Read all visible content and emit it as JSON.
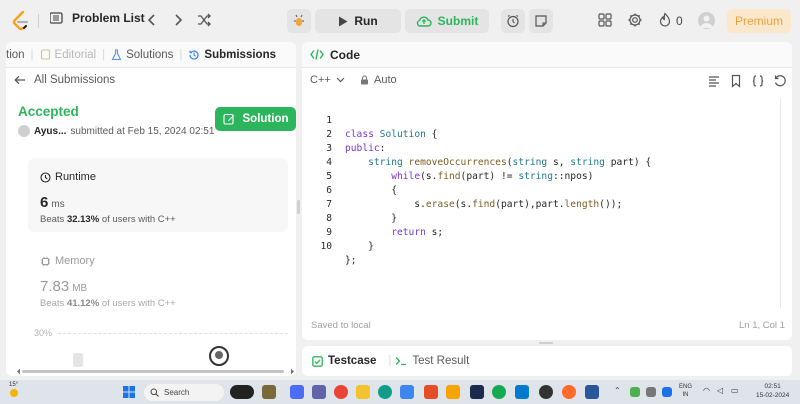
{
  "topbar": {
    "problem_list": "Problem List",
    "run_label": "Run",
    "submit_label": "Submit",
    "streak_count": "0",
    "premium_label": "Premium",
    "colors": {
      "submit_green": "#2db55d",
      "premium_text": "#e8a23a",
      "premium_bg": "#fbe8cc"
    }
  },
  "left_panel": {
    "tabs": [
      {
        "label": "tion"
      },
      {
        "label": "Editorial"
      },
      {
        "label": "Solutions"
      },
      {
        "label": "Submissions"
      }
    ],
    "back_label": "All Submissions",
    "status": "Accepted",
    "solution_button": "Solution",
    "user": "Ayus...",
    "submitted_text": "submitted at Feb 15, 2024 02:51",
    "runtime": {
      "title": "Runtime",
      "value": "6",
      "unit": "ms",
      "beats_prefix": "Beats",
      "beats_pct": "32.13%",
      "beats_suffix": "of users with C++"
    },
    "memory": {
      "title": "Memory",
      "value": "7.83",
      "unit": "MB",
      "beats_prefix": "Beats",
      "beats_pct": "41.12%",
      "beats_suffix": "of users with C++"
    },
    "chart_axis_label": "30%"
  },
  "code_panel": {
    "title": "Code",
    "language": "C++",
    "mode": "Auto",
    "lines": [
      {
        "num": "1",
        "code": "class Solution {"
      },
      {
        "num": "2",
        "code": "public:"
      },
      {
        "num": "3",
        "code": "    string removeOccurrences(string s, string part) {"
      },
      {
        "num": "4",
        "code": "        while(s.find(part) != string::npos)"
      },
      {
        "num": "5",
        "code": "        {"
      },
      {
        "num": "6",
        "code": "            s.erase(s.find(part),part.length());"
      },
      {
        "num": "7",
        "code": "        }"
      },
      {
        "num": "8",
        "code": "        return s;"
      },
      {
        "num": "9",
        "code": "    }"
      },
      {
        "num": "10",
        "code": "};"
      }
    ],
    "saved_text": "Saved to local",
    "cursor_pos": "Ln 1, Col 1"
  },
  "test_panel": {
    "testcase": "Testcase",
    "test_result": "Test Result"
  },
  "taskbar": {
    "weather": "15°",
    "search_label": "Search",
    "lang_top": "ENG",
    "lang_bottom": "IN",
    "time": "02:51",
    "date": "15-02-2024"
  }
}
